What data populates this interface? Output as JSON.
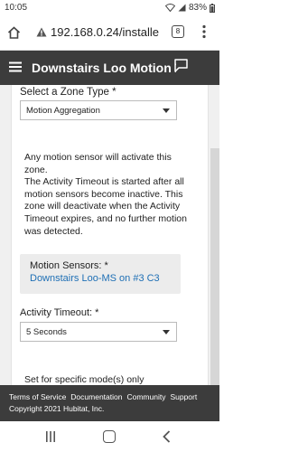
{
  "status_bar": {
    "time": "10:05",
    "battery": "83%"
  },
  "browser": {
    "url": "192.168.0.24/installe",
    "tab_count": "8"
  },
  "header": {
    "title": "Downstairs Loo Motion Z"
  },
  "zone_type": {
    "label": "Select a Zone Type *",
    "selected": "Motion Aggregation"
  },
  "description": {
    "line1": "Any motion sensor will activate this zone.",
    "line2": "The Activity Timeout is started after all motion sensors become inactive. This zone will deactivate when the Activity Timeout expires, and no further motion was detected."
  },
  "motion_sensors": {
    "label": "Motion Sensors: *",
    "value": "Downstairs Loo-MS on #3 C3"
  },
  "activity_timeout": {
    "label": "Activity Timeout: *",
    "selected": "5 Seconds"
  },
  "modes": {
    "label": "Set for specific mode(s) only"
  },
  "footer": {
    "links": [
      "Terms of Service",
      "Documentation",
      "Community",
      "Support"
    ],
    "copyright": "Copyright 2021 Hubitat, Inc."
  },
  "colors": {
    "header_bg": "#3c3c3c",
    "link": "#1e6fb5",
    "content_bg": "#f0f0f0"
  }
}
